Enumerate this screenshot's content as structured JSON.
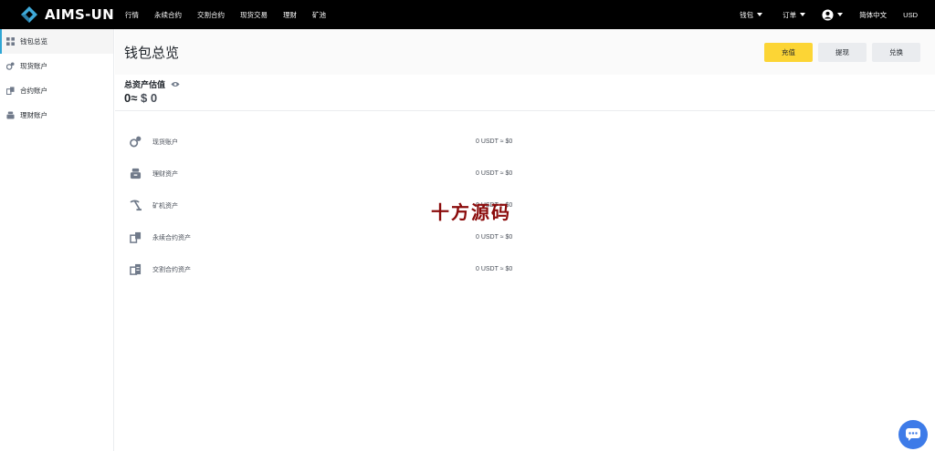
{
  "brand": {
    "name": "AIMS-UN",
    "color": "#3fa9d8"
  },
  "nav": [
    "行情",
    "永续合约",
    "交割合约",
    "现货交易",
    "理财",
    "矿池"
  ],
  "top_right": {
    "wallet": "钱包",
    "orders": "订单",
    "language": "简体中文",
    "currency": "USD"
  },
  "sidebar": {
    "items": [
      {
        "label": "钱包总览",
        "icon": "grid-icon",
        "active": true
      },
      {
        "label": "现货账户",
        "icon": "spot-icon",
        "active": false
      },
      {
        "label": "合约账户",
        "icon": "contract-icon",
        "active": false
      },
      {
        "label": "理财账户",
        "icon": "finance-icon",
        "active": false
      }
    ]
  },
  "main": {
    "title": "钱包总览",
    "buttons": {
      "deposit": "充值",
      "withdraw": "提现",
      "exchange": "兑换"
    },
    "summary": {
      "label": "总资产估值",
      "value": "0",
      "approx": "≈",
      "fiat": "$ 0"
    }
  },
  "assets": [
    {
      "name": "现货账户",
      "value": "0 USDT ≈ $0",
      "icon": "spot-icon"
    },
    {
      "name": "理财资产",
      "value": "0 USDT ≈ $0",
      "icon": "finance-icon"
    },
    {
      "name": "矿机资产",
      "value": "0 USDT ≈ $0",
      "icon": "mining-icon"
    },
    {
      "name": "永续合约资产",
      "value": "0 USDT ≈ $0",
      "icon": "contract-icon"
    },
    {
      "name": "交割合约资产",
      "value": "0 USDT ≈ $0",
      "icon": "delivery-icon"
    }
  ],
  "watermark": "十方源码",
  "colors": {
    "accent": "#fcd535",
    "active_border": "#2fa6d5",
    "chat": "#3d7be8"
  }
}
